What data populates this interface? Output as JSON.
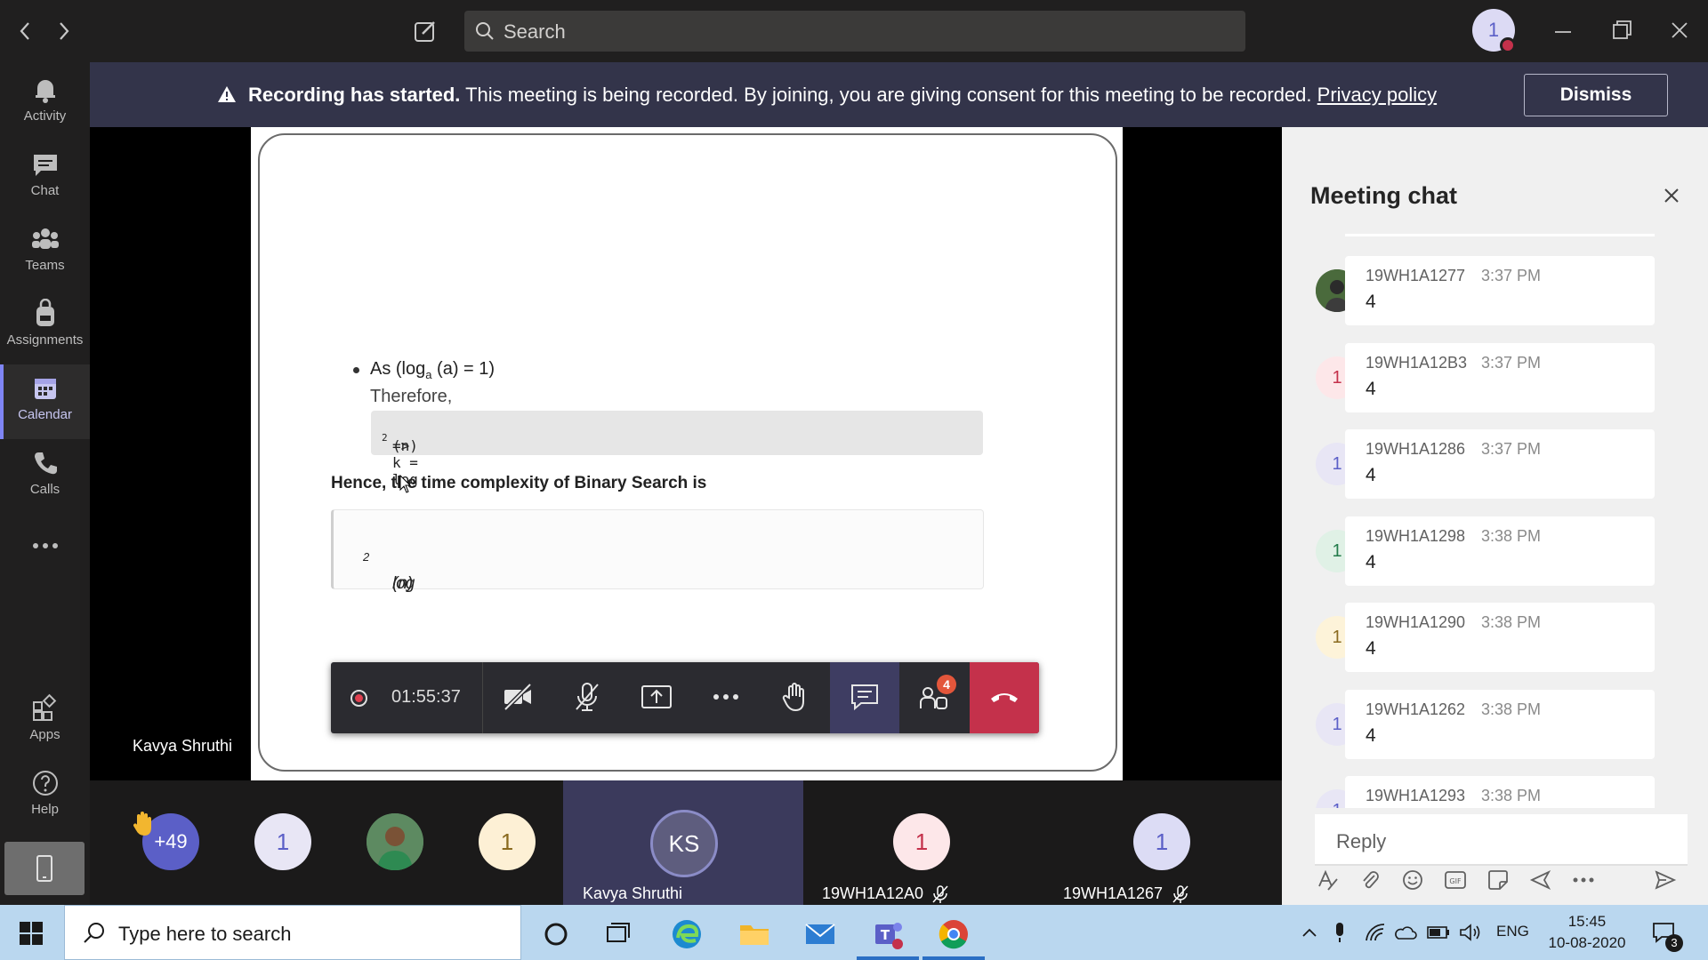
{
  "titlebar": {
    "search_placeholder": "Search",
    "user_initial": "1"
  },
  "rail": {
    "items": [
      {
        "label": "Activity",
        "icon": "bell-icon"
      },
      {
        "label": "Chat",
        "icon": "chat-icon"
      },
      {
        "label": "Teams",
        "icon": "teams-icon"
      },
      {
        "label": "Assignments",
        "icon": "backpack-icon"
      },
      {
        "label": "Calendar",
        "icon": "calendar-icon",
        "active": true
      },
      {
        "label": "Calls",
        "icon": "phone-icon"
      },
      {
        "label": "Apps",
        "icon": "apps-icon"
      },
      {
        "label": "Help",
        "icon": "help-icon"
      }
    ]
  },
  "banner": {
    "bold": "Recording has started.",
    "text": " This meeting is being recorded. By joining, you are giving consent for this meeting to be recorded. ",
    "link": "Privacy policy",
    "dismiss": "Dismiss"
  },
  "slide": {
    "bullet_prefix": "As (log",
    "bullet_sub": "a",
    "bullet_suffix": " (a) = 1)",
    "therefore": "Therefore,",
    "code_prefix": "=> k = log",
    "code_sub": "2",
    "code_suffix": " (n)",
    "hence": "Hence, the time complexity of Binary Search is",
    "answer_prefix": "log",
    "answer_sub": "2",
    "answer_suffix": " (n)"
  },
  "presenter_name": "Kavya Shruthi",
  "controls": {
    "timer": "01:55:37",
    "people_count": "4"
  },
  "participants": {
    "overflow": "+49",
    "tiles": [
      {
        "initial": "1"
      },
      {
        "initial": "1"
      }
    ],
    "main": {
      "initials": "KS",
      "name": "Kavya Shruthi"
    },
    "named": [
      {
        "initial": "1",
        "name": "19WH1A12A0"
      },
      {
        "initial": "1",
        "name": "19WH1A1267"
      }
    ]
  },
  "chat": {
    "title": "Meeting chat",
    "messages": [
      {
        "initial": "",
        "sender": "19WH1A1277",
        "time": "3:37 PM",
        "text": "4",
        "color": "#5a7a4a"
      },
      {
        "initial": "1",
        "sender": "19WH1A12B3",
        "time": "3:37 PM",
        "text": "4",
        "color": "#fde7e9"
      },
      {
        "initial": "1",
        "sender": "19WH1A1286",
        "time": "3:37 PM",
        "text": "4",
        "color": "#e8e6f5"
      },
      {
        "initial": "1",
        "sender": "19WH1A1298",
        "time": "3:38 PM",
        "text": "4",
        "color": "#e0f1e6"
      },
      {
        "initial": "1",
        "sender": "19WH1A1290",
        "time": "3:38 PM",
        "text": "4",
        "color": "#fdf3d9"
      },
      {
        "initial": "1",
        "sender": "19WH1A1262",
        "time": "3:38 PM",
        "text": "4",
        "color": "#e8e6f5"
      },
      {
        "initial": "1",
        "sender": "19WH1A1293",
        "time": "3:38 PM",
        "text": "",
        "color": "#e8e6f5"
      }
    ],
    "reply_placeholder": "Reply"
  },
  "taskbar": {
    "search_placeholder": "Type here to search",
    "lang": "ENG",
    "time": "15:45",
    "date": "10-08-2020",
    "notif_count": "3"
  }
}
